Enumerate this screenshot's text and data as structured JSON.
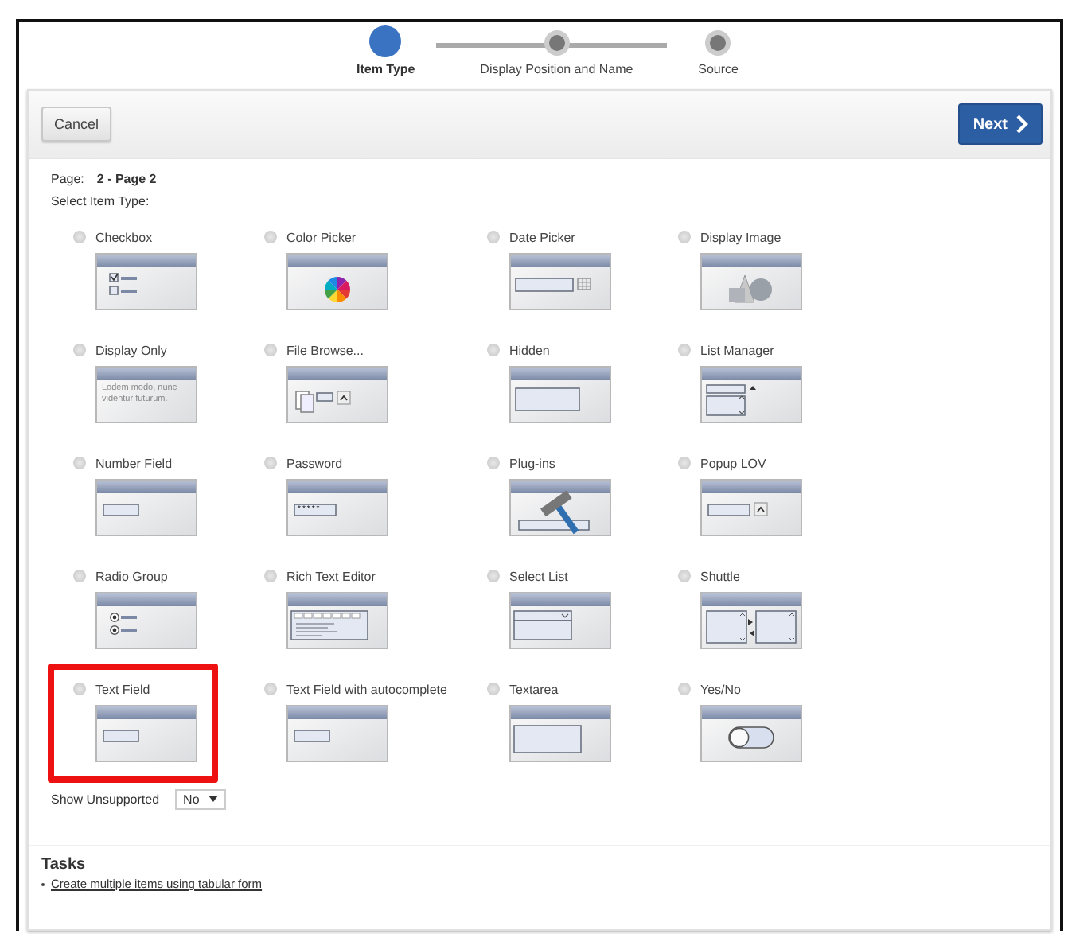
{
  "steps": [
    {
      "label": "Item Type",
      "current": true
    },
    {
      "label": "Display Position and Name",
      "current": false
    },
    {
      "label": "Source",
      "current": false
    }
  ],
  "buttons": {
    "cancel": "Cancel",
    "next": "Next"
  },
  "page": {
    "label": "Page:",
    "value": "2 - Page 2"
  },
  "select_label": "Select Item Type:",
  "item_types": [
    {
      "label": "Checkbox",
      "kind": "checkbox",
      "selected": false,
      "highlighted": false
    },
    {
      "label": "Color Picker",
      "kind": "color",
      "selected": false,
      "highlighted": false
    },
    {
      "label": "Date Picker",
      "kind": "date",
      "selected": false,
      "highlighted": false
    },
    {
      "label": "Display Image",
      "kind": "image",
      "selected": false,
      "highlighted": false
    },
    {
      "label": "Display Only",
      "kind": "display",
      "selected": false,
      "highlighted": false,
      "preview_text": "Lodem modo, nunc videntur futurum."
    },
    {
      "label": "File Browse...",
      "kind": "file",
      "selected": false,
      "highlighted": false
    },
    {
      "label": "Hidden",
      "kind": "hidden",
      "selected": false,
      "highlighted": false
    },
    {
      "label": "List Manager",
      "kind": "listmgr",
      "selected": false,
      "highlighted": false
    },
    {
      "label": "Number Field",
      "kind": "text",
      "selected": false,
      "highlighted": false
    },
    {
      "label": "Password",
      "kind": "password",
      "selected": false,
      "highlighted": false,
      "preview_text": "*****"
    },
    {
      "label": "Plug-ins",
      "kind": "plugin",
      "selected": false,
      "highlighted": false
    },
    {
      "label": "Popup LOV",
      "kind": "popup",
      "selected": false,
      "highlighted": false
    },
    {
      "label": "Radio Group",
      "kind": "radio",
      "selected": false,
      "highlighted": false
    },
    {
      "label": "Rich Text Editor",
      "kind": "richtext",
      "selected": false,
      "highlighted": false
    },
    {
      "label": "Select List",
      "kind": "select",
      "selected": false,
      "highlighted": false
    },
    {
      "label": "Shuttle",
      "kind": "shuttle",
      "selected": false,
      "highlighted": false
    },
    {
      "label": "Text Field",
      "kind": "text",
      "selected": false,
      "highlighted": true
    },
    {
      "label": "Text Field with autocomplete",
      "kind": "text",
      "selected": false,
      "highlighted": false
    },
    {
      "label": "Textarea",
      "kind": "textarea",
      "selected": false,
      "highlighted": false
    },
    {
      "label": "Yes/No",
      "kind": "switch",
      "selected": false,
      "highlighted": false
    }
  ],
  "show_unsupported": {
    "label": "Show Unsupported",
    "value": "No"
  },
  "tasks": {
    "title": "Tasks",
    "links": [
      "Create multiple items using tabular form"
    ]
  }
}
